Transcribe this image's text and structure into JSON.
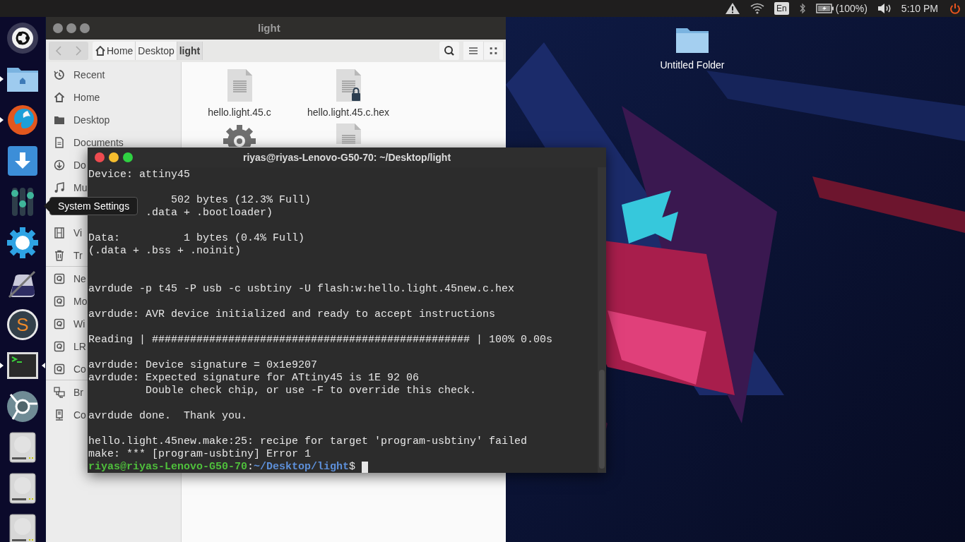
{
  "top_panel": {
    "keyboard_layout": "En",
    "battery": "(100%)",
    "clock": "5:10 PM"
  },
  "launcher": [
    {
      "kind": "logo",
      "running": false,
      "active": false
    },
    {
      "kind": "files",
      "running": true,
      "active": false
    },
    {
      "kind": "browser",
      "running": true,
      "active": false
    },
    {
      "kind": "download",
      "running": false,
      "active": false
    },
    {
      "kind": "sliders",
      "running": false,
      "active": false
    },
    {
      "kind": "gear",
      "running": false,
      "active": false
    },
    {
      "kind": "ink",
      "running": false,
      "active": false
    },
    {
      "kind": "letter",
      "glyph": "S",
      "running": false,
      "active": false
    },
    {
      "kind": "terminal",
      "running": true,
      "active": true
    },
    {
      "kind": "roundbrowser",
      "running": false,
      "active": false
    },
    {
      "kind": "drive",
      "running": false,
      "active": false
    },
    {
      "kind": "drive",
      "running": false,
      "active": false
    },
    {
      "kind": "drive",
      "running": false,
      "active": false
    }
  ],
  "tooltip": "System Settings",
  "desktop_items": [
    {
      "label": "Untitled Folder"
    }
  ],
  "file_manager": {
    "title": "light",
    "breadcrumbs": [
      {
        "label": "Home",
        "home": true,
        "selected": false
      },
      {
        "label": "Desktop",
        "home": false,
        "selected": false
      },
      {
        "label": "light",
        "home": false,
        "selected": true
      }
    ],
    "sidebar": [
      {
        "kind": "clock",
        "label": "Recent"
      },
      {
        "kind": "home",
        "label": "Home"
      },
      {
        "kind": "folder",
        "label": "Desktop"
      },
      {
        "kind": "document",
        "label": "Documents"
      },
      {
        "kind": "download",
        "label": "Do"
      },
      {
        "kind": "music",
        "label": "Mu"
      },
      {
        "kind": "none"
      },
      {
        "kind": "film",
        "label": "Vi"
      },
      {
        "kind": "trash",
        "label": "Tr"
      },
      {
        "kind": "divider"
      },
      {
        "kind": "drive",
        "label": "Ne"
      },
      {
        "kind": "drive",
        "label": "Mo"
      },
      {
        "kind": "drive",
        "label": "Wi"
      },
      {
        "kind": "drive",
        "label": "LR"
      },
      {
        "kind": "drive",
        "label": "Co"
      },
      {
        "kind": "divider"
      },
      {
        "kind": "network",
        "label": "Br"
      },
      {
        "kind": "server",
        "label": "Co"
      }
    ],
    "files": [
      {
        "kind": "text",
        "name": "hello.light.45.c",
        "locked": false
      },
      {
        "kind": "text",
        "name": "hello.light.45.c.hex",
        "locked": true
      },
      {
        "kind": "executable"
      },
      {
        "kind": "text"
      }
    ]
  },
  "terminal": {
    "title": "riyas@riyas-Lenovo-G50-70: ~/Desktop/light",
    "lines": [
      {
        "kind": "output",
        "text": "Device: attiny45"
      },
      {
        "kind": "blank"
      },
      {
        "kind": "output",
        "text": "             502 bytes (12.3% Full)"
      },
      {
        "kind": "output",
        "text": "         .data + .bootloader)"
      },
      {
        "kind": "blank"
      },
      {
        "kind": "output",
        "text": "Data:          1 bytes (0.4% Full)"
      },
      {
        "kind": "output",
        "text": "(.data + .bss + .noinit)"
      },
      {
        "kind": "blank"
      },
      {
        "kind": "blank"
      },
      {
        "kind": "output",
        "text": "avrdude -p t45 -P usb -c usbtiny -U flash:w:hello.light.45new.c.hex"
      },
      {
        "kind": "blank"
      },
      {
        "kind": "output",
        "text": "avrdude: AVR device initialized and ready to accept instructions"
      },
      {
        "kind": "blank"
      },
      {
        "kind": "output",
        "text": "Reading | ################################################## | 100% 0.00s"
      },
      {
        "kind": "blank"
      },
      {
        "kind": "output",
        "text": "avrdude: Device signature = 0x1e9207"
      },
      {
        "kind": "output",
        "text": "avrdude: Expected signature for ATtiny45 is 1E 92 06"
      },
      {
        "kind": "output",
        "text": "         Double check chip, or use -F to override this check."
      },
      {
        "kind": "blank"
      },
      {
        "kind": "output",
        "text": "avrdude done.  Thank you."
      },
      {
        "kind": "blank"
      },
      {
        "kind": "output",
        "text": "hello.light.45new.make:25: recipe for target 'program-usbtiny' failed"
      },
      {
        "kind": "output",
        "text": "make: *** [program-usbtiny] Error 1"
      },
      {
        "kind": "prompt",
        "user": "riyas@riyas-Lenovo-G50-70",
        "separator": ":",
        "path": "~/Desktop/light",
        "symbol": "$"
      }
    ]
  }
}
